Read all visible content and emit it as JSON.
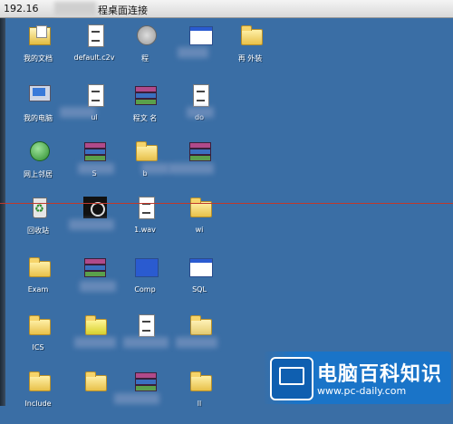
{
  "window": {
    "title_ip": "192.16",
    "title_text": "程桌面连接"
  },
  "desktop": {
    "icons": [
      {
        "id": "my-documents",
        "label": "我的文档",
        "icon": "my-documents-icon"
      },
      {
        "id": "default-c2v",
        "label": "default.c2v",
        "icon": "document-icon"
      },
      {
        "id": "app-r1c3",
        "label": "程",
        "icon": "app-icon"
      },
      {
        "id": "window-r1c4",
        "label": "",
        "icon": "window-icon"
      },
      {
        "id": "folder-r1c5",
        "label": "再 外装",
        "icon": "folder-icon"
      },
      {
        "id": "my-computer",
        "label": "我的电脑",
        "icon": "computer-icon"
      },
      {
        "id": "doc-r2c2",
        "label": "ul",
        "icon": "document-icon"
      },
      {
        "id": "rar-r2c3",
        "label": "程文 名",
        "icon": "archive-icon"
      },
      {
        "id": "doc-r2c4",
        "label": "do",
        "icon": "document-icon"
      },
      {
        "id": "network",
        "label": "网上邻居",
        "icon": "network-icon"
      },
      {
        "id": "rar-r3c2",
        "label": "S",
        "icon": "archive-icon"
      },
      {
        "id": "folder-r3c3",
        "label": "b",
        "icon": "folder-icon"
      },
      {
        "id": "rar-r3c4",
        "label": "",
        "icon": "archive-icon"
      },
      {
        "id": "recycle-bin",
        "label": "回收站",
        "icon": "recycle-bin-icon"
      },
      {
        "id": "image-r4c2",
        "label": "",
        "icon": "image-icon"
      },
      {
        "id": "wav-file",
        "label": "1.wav",
        "icon": "audio-file-icon"
      },
      {
        "id": "folder-r4c4",
        "label": "wi",
        "icon": "folder-icon"
      },
      {
        "id": "exam",
        "label": "Exam",
        "icon": "folder-icon"
      },
      {
        "id": "rar-r5c2",
        "label": "",
        "icon": "archive-icon"
      },
      {
        "id": "comp",
        "label": "Comp",
        "icon": "app-icon"
      },
      {
        "id": "sql",
        "label": "SQL",
        "icon": "window-icon"
      },
      {
        "id": "ics",
        "label": "ICS",
        "icon": "folder-icon"
      },
      {
        "id": "item-r6c2",
        "label": "",
        "icon": "app-icon"
      },
      {
        "id": "doc-r6c3",
        "label": "",
        "icon": "document-icon"
      },
      {
        "id": "folder-r6c4",
        "label": "",
        "icon": "folder-icon"
      },
      {
        "id": "include",
        "label": "Include",
        "icon": "folder-icon"
      },
      {
        "id": "folder-r7c2",
        "label": "",
        "icon": "folder-icon"
      },
      {
        "id": "rar-r7c3",
        "label": "",
        "icon": "archive-icon"
      },
      {
        "id": "folder-r7c4",
        "label": "ll",
        "icon": "folder-icon"
      }
    ]
  },
  "logo": {
    "name": "电脑百科知识",
    "url": "www.pc-daily.com"
  }
}
